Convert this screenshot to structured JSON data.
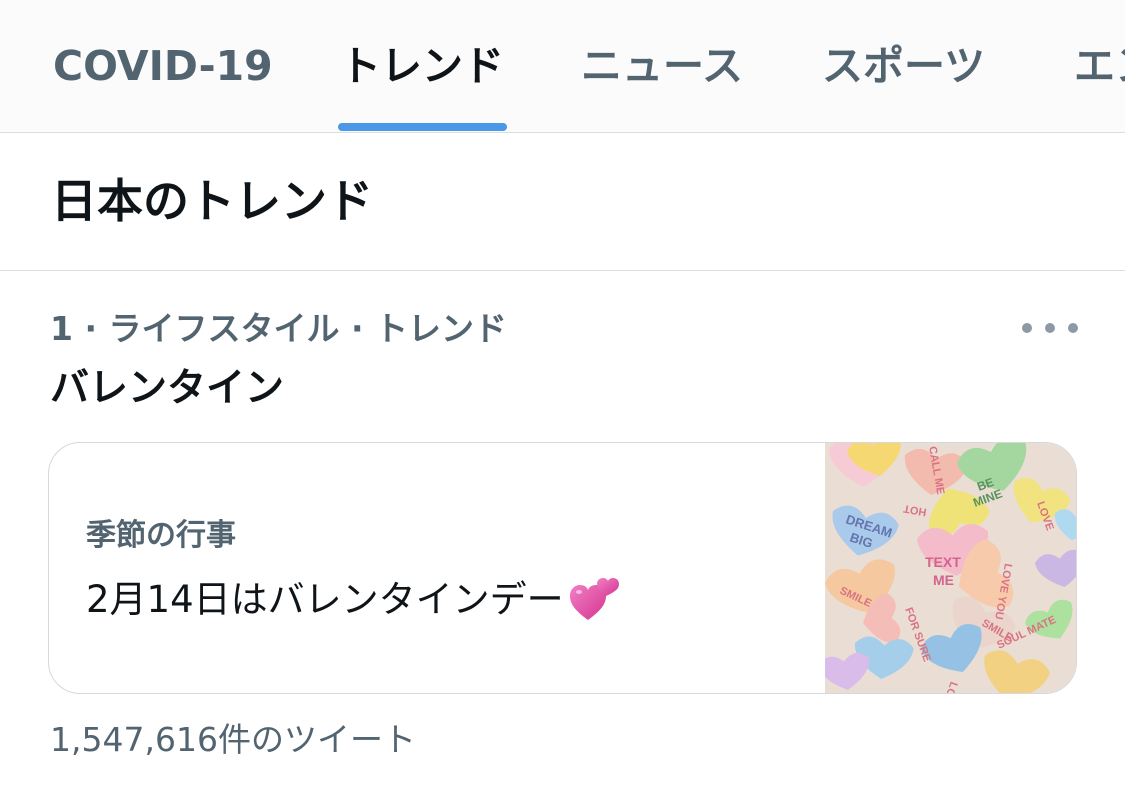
{
  "tabs": [
    {
      "label": "COVID-19",
      "active": false
    },
    {
      "label": "トレンド",
      "active": true
    },
    {
      "label": "ニュース",
      "active": false
    },
    {
      "label": "スポーツ",
      "active": false
    },
    {
      "label": "エン",
      "active": false
    }
  ],
  "section": {
    "title": "日本のトレンド"
  },
  "trend": {
    "meta": "1 · ライフスタイル · トレンド",
    "name": "バレンタイン",
    "more_icon": "more-horizontal-icon",
    "card": {
      "category": "季節の行事",
      "headline": "2月14日はバレンタインデー",
      "emoji": "two-hearts-icon",
      "image": "candy-hearts-image",
      "image_texts": [
        "DREAM BIG",
        "TEXT ME",
        "BE MINE",
        "SMILE",
        "LOVE YOU",
        "HOT",
        "CALL ME",
        "FOR SURE",
        "LOVE",
        "SOUL MATE",
        "LOVE BUG"
      ]
    },
    "tweet_count": "1,547,616件のツイート"
  },
  "colors": {
    "accent": "#4b98e7",
    "text_primary": "#0f1419",
    "text_secondary": "#536471",
    "border": "#d9dee2"
  }
}
